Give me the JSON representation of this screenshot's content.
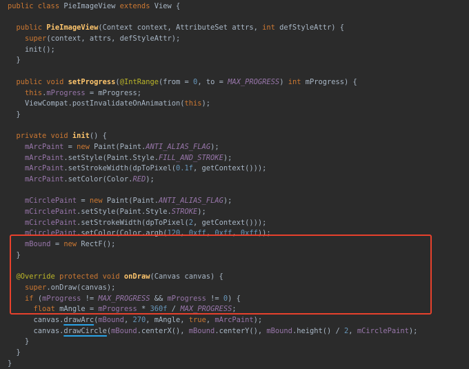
{
  "lines": [
    [
      {
        "t": "public class ",
        "c": "kw"
      },
      {
        "t": "PieImageView ",
        "c": ""
      },
      {
        "t": "extends ",
        "c": "kw"
      },
      {
        "t": "View {",
        "c": ""
      }
    ],
    [],
    [
      {
        "t": "  public ",
        "c": "kw"
      },
      {
        "t": "PieImageView",
        "c": "fn"
      },
      {
        "t": "(Context context, AttributeSet attrs, ",
        "c": ""
      },
      {
        "t": "int ",
        "c": "kw"
      },
      {
        "t": "defStyleAttr) {",
        "c": ""
      }
    ],
    [
      {
        "t": "    ",
        "c": ""
      },
      {
        "t": "super",
        "c": "kw"
      },
      {
        "t": "(context, attrs, defStyleAttr);",
        "c": ""
      }
    ],
    [
      {
        "t": "    init();",
        "c": ""
      }
    ],
    [
      {
        "t": "  }",
        "c": ""
      }
    ],
    [],
    [
      {
        "t": "  public void ",
        "c": "kw"
      },
      {
        "t": "setProgress",
        "c": "fn"
      },
      {
        "t": "(",
        "c": ""
      },
      {
        "t": "@IntRange",
        "c": "ann"
      },
      {
        "t": "(from = ",
        "c": ""
      },
      {
        "t": "0",
        "c": "num"
      },
      {
        "t": ", to = ",
        "c": ""
      },
      {
        "t": "MAX_PROGRESS",
        "c": "static-field"
      },
      {
        "t": ") ",
        "c": ""
      },
      {
        "t": "int ",
        "c": "kw"
      },
      {
        "t": "mProgress) {",
        "c": ""
      }
    ],
    [
      {
        "t": "    ",
        "c": ""
      },
      {
        "t": "this",
        "c": "kw"
      },
      {
        "t": ".",
        "c": ""
      },
      {
        "t": "mProgress",
        "c": "field"
      },
      {
        "t": " = mProgress;",
        "c": ""
      }
    ],
    [
      {
        "t": "    ViewCompat.",
        "c": ""
      },
      {
        "t": "postInvalidateOnAnimation",
        "c": ""
      },
      {
        "t": "(",
        "c": ""
      },
      {
        "t": "this",
        "c": "kw"
      },
      {
        "t": ");",
        "c": ""
      }
    ],
    [
      {
        "t": "  }",
        "c": ""
      }
    ],
    [],
    [
      {
        "t": "  private void ",
        "c": "kw"
      },
      {
        "t": "init",
        "c": "fn"
      },
      {
        "t": "() {",
        "c": ""
      }
    ],
    [
      {
        "t": "    ",
        "c": ""
      },
      {
        "t": "mArcPaint",
        "c": "field"
      },
      {
        "t": " = ",
        "c": ""
      },
      {
        "t": "new ",
        "c": "kw"
      },
      {
        "t": "Paint(Paint.",
        "c": ""
      },
      {
        "t": "ANTI_ALIAS_FLAG",
        "c": "static-field"
      },
      {
        "t": ");",
        "c": ""
      }
    ],
    [
      {
        "t": "    ",
        "c": ""
      },
      {
        "t": "mArcPaint",
        "c": "field"
      },
      {
        "t": ".setStyle(Paint.Style.",
        "c": ""
      },
      {
        "t": "FILL_AND_STROKE",
        "c": "static-field"
      },
      {
        "t": ");",
        "c": ""
      }
    ],
    [
      {
        "t": "    ",
        "c": ""
      },
      {
        "t": "mArcPaint",
        "c": "field"
      },
      {
        "t": ".setStrokeWidth(dpToPixel(",
        "c": ""
      },
      {
        "t": "0.1f",
        "c": "num"
      },
      {
        "t": ", getContext()));",
        "c": ""
      }
    ],
    [
      {
        "t": "    ",
        "c": ""
      },
      {
        "t": "mArcPaint",
        "c": "field"
      },
      {
        "t": ".setColor(Color.",
        "c": ""
      },
      {
        "t": "RED",
        "c": "static-field"
      },
      {
        "t": ");",
        "c": ""
      }
    ],
    [],
    [
      {
        "t": "    ",
        "c": ""
      },
      {
        "t": "mCirclePaint",
        "c": "field"
      },
      {
        "t": " = ",
        "c": ""
      },
      {
        "t": "new ",
        "c": "kw"
      },
      {
        "t": "Paint(Paint.",
        "c": ""
      },
      {
        "t": "ANTI_ALIAS_FLAG",
        "c": "static-field"
      },
      {
        "t": ");",
        "c": ""
      }
    ],
    [
      {
        "t": "    ",
        "c": ""
      },
      {
        "t": "mCirclePaint",
        "c": "field"
      },
      {
        "t": ".setStyle(Paint.Style.",
        "c": ""
      },
      {
        "t": "STROKE",
        "c": "static-field"
      },
      {
        "t": ");",
        "c": ""
      }
    ],
    [
      {
        "t": "    ",
        "c": ""
      },
      {
        "t": "mCirclePaint",
        "c": "field"
      },
      {
        "t": ".setStrokeWidth(dpToPixel(",
        "c": ""
      },
      {
        "t": "2",
        "c": "num"
      },
      {
        "t": ", getContext()));",
        "c": ""
      }
    ],
    [
      {
        "t": "    ",
        "c": ""
      },
      {
        "t": "mCirclePaint",
        "c": "field"
      },
      {
        "t": ".setColor(Color.argb(",
        "c": ""
      },
      {
        "t": "120",
        "c": "num"
      },
      {
        "t": ", ",
        "c": ""
      },
      {
        "t": "0xff",
        "c": "num"
      },
      {
        "t": ", ",
        "c": ""
      },
      {
        "t": "0xff",
        "c": "num"
      },
      {
        "t": ", ",
        "c": ""
      },
      {
        "t": "0xff",
        "c": "num"
      },
      {
        "t": "));",
        "c": ""
      }
    ],
    [
      {
        "t": "    ",
        "c": ""
      },
      {
        "t": "mBound",
        "c": "field"
      },
      {
        "t": " = ",
        "c": ""
      },
      {
        "t": "new ",
        "c": "kw"
      },
      {
        "t": "RectF();",
        "c": ""
      }
    ],
    [
      {
        "t": "  }",
        "c": ""
      }
    ],
    [],
    [
      {
        "t": "  ",
        "c": ""
      },
      {
        "t": "@Override ",
        "c": "ann"
      },
      {
        "t": "protected void ",
        "c": "kw"
      },
      {
        "t": "onDraw",
        "c": "fn"
      },
      {
        "t": "(Canvas canvas) {",
        "c": ""
      }
    ],
    [
      {
        "t": "    ",
        "c": ""
      },
      {
        "t": "super",
        "c": "kw"
      },
      {
        "t": ".onDraw(canvas);",
        "c": ""
      }
    ],
    [
      {
        "t": "    ",
        "c": ""
      },
      {
        "t": "if ",
        "c": "kw"
      },
      {
        "t": "(",
        "c": ""
      },
      {
        "t": "mProgress",
        "c": "field"
      },
      {
        "t": " != ",
        "c": ""
      },
      {
        "t": "MAX_PROGRESS",
        "c": "static-field"
      },
      {
        "t": " && ",
        "c": ""
      },
      {
        "t": "mProgress",
        "c": "field"
      },
      {
        "t": " != ",
        "c": ""
      },
      {
        "t": "0",
        "c": "num"
      },
      {
        "t": ") {",
        "c": ""
      }
    ],
    [
      {
        "t": "      ",
        "c": ""
      },
      {
        "t": "float ",
        "c": "kw"
      },
      {
        "t": "mAngle = ",
        "c": ""
      },
      {
        "t": "mProgress",
        "c": "field"
      },
      {
        "t": " * ",
        "c": ""
      },
      {
        "t": "360f",
        "c": "num"
      },
      {
        "t": " / ",
        "c": ""
      },
      {
        "t": "MAX_PROGRESS",
        "c": "static-field"
      },
      {
        "t": ";",
        "c": ""
      }
    ],
    [
      {
        "t": "      canvas.",
        "c": ""
      },
      {
        "t": "drawArc",
        "c": "squiggle"
      },
      {
        "t": "(",
        "c": ""
      },
      {
        "t": "mBound",
        "c": "field"
      },
      {
        "t": ", ",
        "c": ""
      },
      {
        "t": "270",
        "c": "num"
      },
      {
        "t": ", mAngle, ",
        "c": ""
      },
      {
        "t": "true",
        "c": "kw"
      },
      {
        "t": ", ",
        "c": ""
      },
      {
        "t": "mArcPaint",
        "c": "field"
      },
      {
        "t": ");",
        "c": ""
      }
    ],
    [
      {
        "t": "      canvas.",
        "c": ""
      },
      {
        "t": "drawCircle",
        "c": "squiggle"
      },
      {
        "t": "(",
        "c": ""
      },
      {
        "t": "mBound",
        "c": "field"
      },
      {
        "t": ".centerX(), ",
        "c": ""
      },
      {
        "t": "mBound",
        "c": "field"
      },
      {
        "t": ".centerY(), ",
        "c": ""
      },
      {
        "t": "mBound",
        "c": "field"
      },
      {
        "t": ".height() / ",
        "c": ""
      },
      {
        "t": "2",
        "c": "num"
      },
      {
        "t": ", ",
        "c": ""
      },
      {
        "t": "mCirclePaint",
        "c": "field"
      },
      {
        "t": ");",
        "c": ""
      }
    ],
    [
      {
        "t": "    }",
        "c": ""
      }
    ],
    [
      {
        "t": "  }",
        "c": ""
      }
    ],
    [
      {
        "t": "}",
        "c": ""
      }
    ]
  ],
  "colors": {
    "background": "#2b2b2b",
    "default_text": "#a9b7c6",
    "keyword": "#cc7832",
    "annotation": "#bbb529",
    "method_decl": "#ffc66d",
    "field": "#9876aa",
    "number": "#6897bb",
    "highlight_border": "#e8412c",
    "squiggle_underline": "#2aa3e8"
  }
}
